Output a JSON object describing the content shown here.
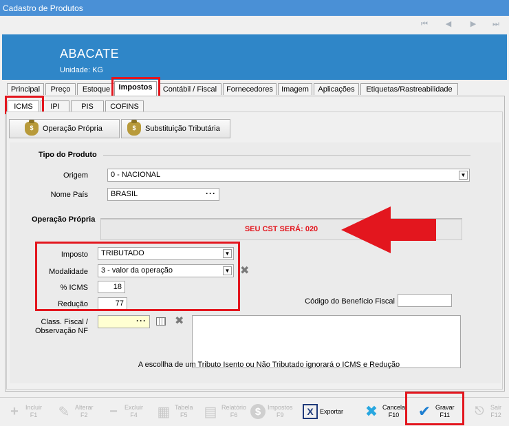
{
  "window": {
    "title": "Cadastro de Produtos"
  },
  "nav_icons": [
    "first-icon",
    "prev-icon",
    "next-icon",
    "last-icon"
  ],
  "product": {
    "name": "ABACATE",
    "unit": "Unidade:  KG"
  },
  "tabs": [
    {
      "label": "Principal"
    },
    {
      "label": "Preço"
    },
    {
      "label": "Estoque"
    },
    {
      "label": "Impostos"
    },
    {
      "label": "Contábil / Fiscal"
    },
    {
      "label": "Fornecedores"
    },
    {
      "label": "Imagem"
    },
    {
      "label": "Aplicações"
    },
    {
      "label": "Etiquetas/Rastreabilidade"
    }
  ],
  "subtabs": [
    {
      "label": "ICMS"
    },
    {
      "label": "IPI"
    },
    {
      "label": "PIS"
    },
    {
      "label": "COFINS"
    }
  ],
  "buttons": {
    "operacao_propria": "Operação Própria",
    "substituicao": "Substituição Tributária"
  },
  "tipo_produto": {
    "title": "Tipo do Produto",
    "origem_label": "Origem",
    "origem_value": "0 - NACIONAL",
    "pais_label": "Nome País",
    "pais_value": "BRASIL"
  },
  "operacao": {
    "title": "Operação Própria",
    "cst_message": "SEU CST SERÁ: 020",
    "imposto_label": "Imposto",
    "imposto_value": "TRIBUTADO",
    "modalidade_label": "Modalidade",
    "modalidade_value": "3 - valor da operação",
    "icms_label": "% ICMS",
    "icms_value": "18",
    "reducao_label": "Redução",
    "reducao_value": "77",
    "beneficio_label": "Código do Benefício Fiscal",
    "beneficio_value": "",
    "class_fiscal_label_1": "Class. Fiscal /",
    "class_fiscal_label_2": "Observação NF",
    "class_fiscal_value": ""
  },
  "footnote": "A escollha de um Tributo Isento ou Não Tributado ignorará o ICMS e Redução",
  "toolbar": [
    {
      "label": "Incluir",
      "key": "F1",
      "icon": "plus-icon",
      "enabled": false
    },
    {
      "label": "Alterar",
      "key": "F2",
      "icon": "pencil-icon",
      "enabled": false
    },
    {
      "label": "Excluir",
      "key": "F4",
      "icon": "minus-icon",
      "enabled": false
    },
    {
      "label": "Tabela",
      "key": "F5",
      "icon": "table-icon",
      "enabled": false
    },
    {
      "label": "Relatório",
      "key": "F6",
      "icon": "report-icon",
      "enabled": false
    },
    {
      "label": "Impostos",
      "key": "F9",
      "icon": "dollar-icon",
      "enabled": false
    },
    {
      "label": "Exportar",
      "key": "",
      "icon": "excel-icon",
      "enabled": true
    },
    {
      "label": "Cancela",
      "key": "F10",
      "icon": "cancel-x-icon",
      "enabled": true
    },
    {
      "label": "Gravar",
      "key": "F11",
      "icon": "checkmark-icon",
      "enabled": true
    },
    {
      "label": "Sair",
      "key": "F12",
      "icon": "exit-icon",
      "enabled": false
    }
  ],
  "colors": {
    "accent": "#2f86c8",
    "titlebar": "#4a90d6",
    "highlight": "#e3161e",
    "cst_text": "#e3161e"
  }
}
